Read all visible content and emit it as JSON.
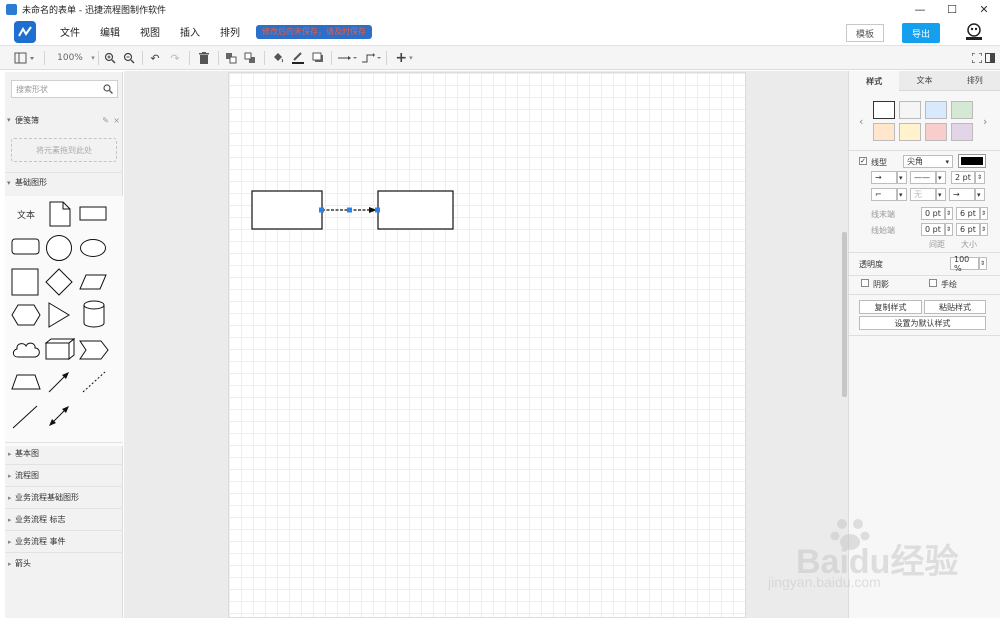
{
  "window": {
    "title": "未命名的表单 - 迅捷流程图制作软件",
    "controls": [
      "—",
      "☐",
      "✕"
    ]
  },
  "menu": {
    "items": [
      "文件",
      "编辑",
      "视图",
      "插入",
      "排列"
    ],
    "notice": "修改后的未保存，请及时保存",
    "template_label": "模板",
    "export_label": "导出"
  },
  "toolbar": {
    "zoom": "100%"
  },
  "left": {
    "search_placeholder": "搜索形状",
    "notes_section": "便笺簿",
    "drop_hint": "将元素拖到此处",
    "basic_section": "基础图形",
    "text_shape": "文本",
    "collapsed": [
      "基本图",
      "流程图",
      "业务流程基础图形",
      "业务流程 标志",
      "业务流程 事件",
      "箭头"
    ]
  },
  "right": {
    "tabs": [
      "样式",
      "文本",
      "排列"
    ],
    "swatch_colors": [
      "#ffffff",
      "#f5f5f5",
      "#dae8fc",
      "#d5e8d4",
      "#ffe6cc",
      "#fff2cc",
      "#f8cecc",
      "#e1d5e7"
    ],
    "line_type_label": "线型",
    "line_type_value": "尖角",
    "line_color": "#000000",
    "line_width": "2 pt",
    "line_end_label": "线末端",
    "line_start_label": "线始端",
    "line_end_spacing": "0 pt",
    "line_end_size": "6 pt",
    "line_start_spacing": "0 pt",
    "line_start_size": "6 pt",
    "spacing_label": "间距",
    "size_label": "大小",
    "none_label": "无",
    "opacity_label": "透明度",
    "opacity_value": "100 %",
    "shadow_label": "阴影",
    "handdrawn_label": "手绘",
    "copy_style": "复制样式",
    "paste_style": "粘贴样式",
    "set_default": "设置为默认样式"
  },
  "watermark": {
    "brand": "Baidu经验",
    "url": "jingyan.baidu.com"
  }
}
